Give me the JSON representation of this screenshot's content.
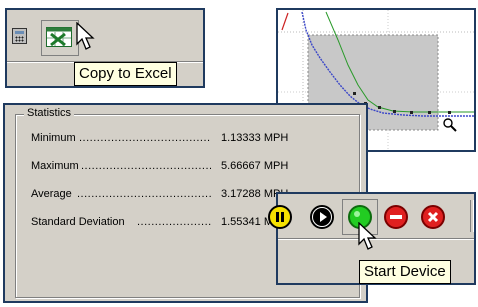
{
  "toolbar_excel": {
    "calculator_icon": "calculator-icon",
    "excel_icon": "excel-icon",
    "tooltip": "Copy to Excel"
  },
  "chart": {
    "colors": {
      "blue": "#3a46c8",
      "green": "#2a9a2a",
      "red": "#cc2222",
      "selection": "#c8c8c8",
      "grid": "#9a9a9a"
    }
  },
  "statistics": {
    "title": "Statistics",
    "rows": [
      {
        "label": "Minimum",
        "value": "1.13333 MPH"
      },
      {
        "label": "Maximum",
        "value": "5.66667 MPH"
      },
      {
        "label": "Average",
        "value": "3.17288 MPH"
      },
      {
        "label": "Standard Deviation",
        "value": "1.55341 MPH"
      }
    ]
  },
  "device_toolbar": {
    "buttons": [
      "pause-icon",
      "play-icon",
      "start-icon",
      "stop-icon",
      "cancel-icon"
    ],
    "tooltip": "Start Device"
  }
}
